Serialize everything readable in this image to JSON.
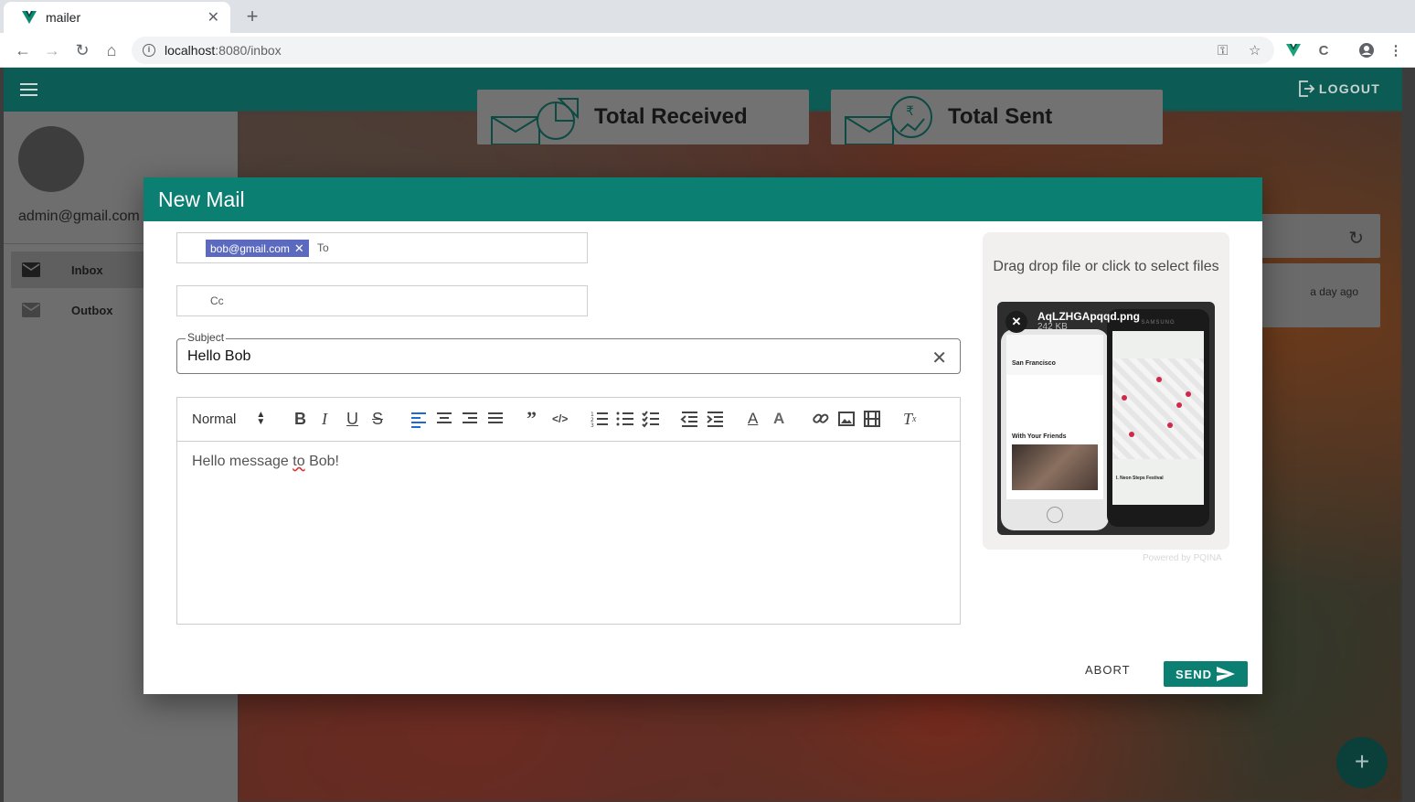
{
  "browser": {
    "tab_title": "mailer",
    "url_host": "localhost",
    "url_path": ":8080/inbox"
  },
  "appbar": {
    "logout_label": "LOGOUT"
  },
  "sidebar": {
    "email": "admin@gmail.com",
    "items": [
      {
        "label": "Inbox",
        "icon": "mail-icon"
      },
      {
        "label": "Outbox",
        "icon": "mail-icon"
      }
    ]
  },
  "stats": {
    "received_title": "Total Received",
    "sent_title": "Total Sent"
  },
  "inbox": {
    "row_time": "a day ago"
  },
  "dialog": {
    "title": "New Mail",
    "to_chip": "bob@gmail.com",
    "to_placeholder": "To",
    "cc_placeholder": "Cc",
    "subject_label": "Subject",
    "subject_value": "Hello Bob",
    "format_select": "Normal",
    "body_before": "Hello message ",
    "body_misspelled": "to",
    "body_after": " Bob!",
    "dropzone_label": "Drag drop file or click to select files",
    "file_name": "AqLZHGApqqd.png",
    "file_size": "242 KB",
    "preview_city": "San Francisco",
    "preview_friends": "With Your Friends",
    "preview_brand": "SAMSUNG",
    "preview_event": "I. Neon Steps Festival",
    "powered_by": "Powered by PQINA",
    "abort_label": "ABORT",
    "send_label": "SEND"
  },
  "colors": {
    "appbar": "#0c5c55",
    "dialog_header": "#0b7f72",
    "chip": "#5b6abf",
    "send_button": "#0b7f72"
  }
}
